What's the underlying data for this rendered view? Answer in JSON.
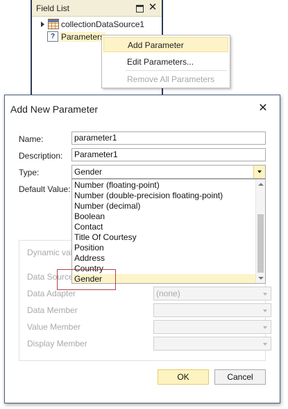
{
  "field_list": {
    "title": "Field List",
    "items": [
      {
        "label": "collectionDataSource1",
        "icon": "table-icon"
      },
      {
        "label": "Parameters",
        "icon": "parameter-icon"
      }
    ]
  },
  "context_menu": {
    "items": [
      {
        "label": "Add Parameter",
        "state": "hover"
      },
      {
        "label": "Edit Parameters...",
        "state": "normal"
      },
      {
        "label": "Remove All Parameters",
        "state": "disabled"
      }
    ]
  },
  "dialog": {
    "title": "Add New Parameter",
    "name_label": "Name:",
    "name_value": "parameter1",
    "description_label": "Description:",
    "description_value": "Parameter1",
    "type_label": "Type:",
    "type_value": "Gender",
    "default_value_label": "Default Value:",
    "dynamic_values_label": "Dynamic valu",
    "data_source_label": "Data Source",
    "data_adapter_label": "Data Adapter",
    "data_adapter_value": "(none)",
    "data_member_label": "Data Member",
    "value_member_label": "Value Member",
    "display_member_label": "Display Member",
    "ok_label": "OK",
    "cancel_label": "Cancel"
  },
  "type_dropdown": {
    "options": [
      "Number (floating-point)",
      "Number (double-precision floating-point)",
      "Number (decimal)",
      "Boolean",
      "Contact",
      "Title Of Courtesy",
      "Position",
      "Address",
      "Country",
      "Gender"
    ],
    "selected": "Gender"
  },
  "colors": {
    "highlight": "#fdf3c8",
    "callout_border": "#b5404a",
    "window_border": "#2b3a55"
  }
}
